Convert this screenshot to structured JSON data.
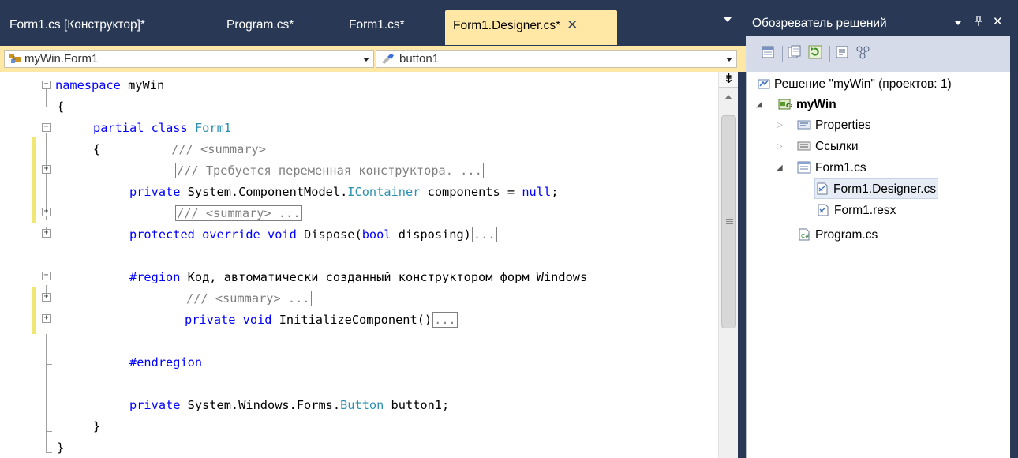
{
  "tabs": [
    {
      "label": "Form1.cs [Конструктор]*",
      "active": false
    },
    {
      "label": "Program.cs*",
      "active": false
    },
    {
      "label": "Form1.cs*",
      "active": false
    },
    {
      "label": "Form1.Designer.cs*",
      "active": true
    }
  ],
  "tab_close_symbol": "✕",
  "nav": {
    "class_combo": "myWin.Form1",
    "member_combo": "button1"
  },
  "code": {
    "l1_kw": "namespace",
    "l1_rest": " myWin",
    "l2": "{",
    "l3_kw": "partial class",
    "l3_type": "Form1",
    "l4_brace": "{",
    "l4_comment": "/// <summary>",
    "l5_comment": "/// Требуется переменная конструктора. ...",
    "l6_kw": "private",
    "l6_mid": " System.ComponentModel.",
    "l6_type": "IContainer",
    "l6_rest": " components = ",
    "l6_null": "null",
    "l6_end": ";",
    "l7_comment": "/// <summary> ...",
    "l8_kw": "protected override void",
    "l8_mid": " Dispose(",
    "l8_kw2": "bool",
    "l8_rest": " disposing)",
    "l8_ellipsis": "...",
    "l10_kw": "#region",
    "l10_rest": " Код, автоматически созданный конструктором форм Windows",
    "l11_comment": "/// <summary> ...",
    "l12_kw": "private void",
    "l12_rest": " InitializeComponent()",
    "l12_ellipsis": "...",
    "l14_kw": "#endregion",
    "l16_kw": "private",
    "l16_mid": " System.Windows.Forms.",
    "l16_type": "Button",
    "l16_rest": " button1;",
    "l17": "}",
    "l18": "}"
  },
  "solution_explorer": {
    "title": "Обозреватель решений",
    "pin_symbol": "ᵖ",
    "close_symbol": "✕",
    "solution": "Решение \"myWin\"  (проектов: 1)",
    "project": "myWin",
    "items": {
      "properties": "Properties",
      "references": "Ссылки",
      "form1": "Form1.cs",
      "designer": "Form1.Designer.cs",
      "resx": "Form1.resx",
      "program": "Program.cs"
    }
  },
  "colors": {
    "chrome_dark": "#293955",
    "active_tab": "#ffe8a6",
    "keyword": "#0000ff",
    "type": "#2b91af",
    "comment": "#808080",
    "change_marker": "#efe676"
  },
  "icons": [
    "tab-dropdown-icon",
    "class-icon",
    "field-icon",
    "close-icon",
    "pin-icon",
    "solution-icon",
    "project-icon",
    "properties-icon",
    "references-icon",
    "form-icon",
    "cs-file-icon",
    "resx-icon"
  ]
}
